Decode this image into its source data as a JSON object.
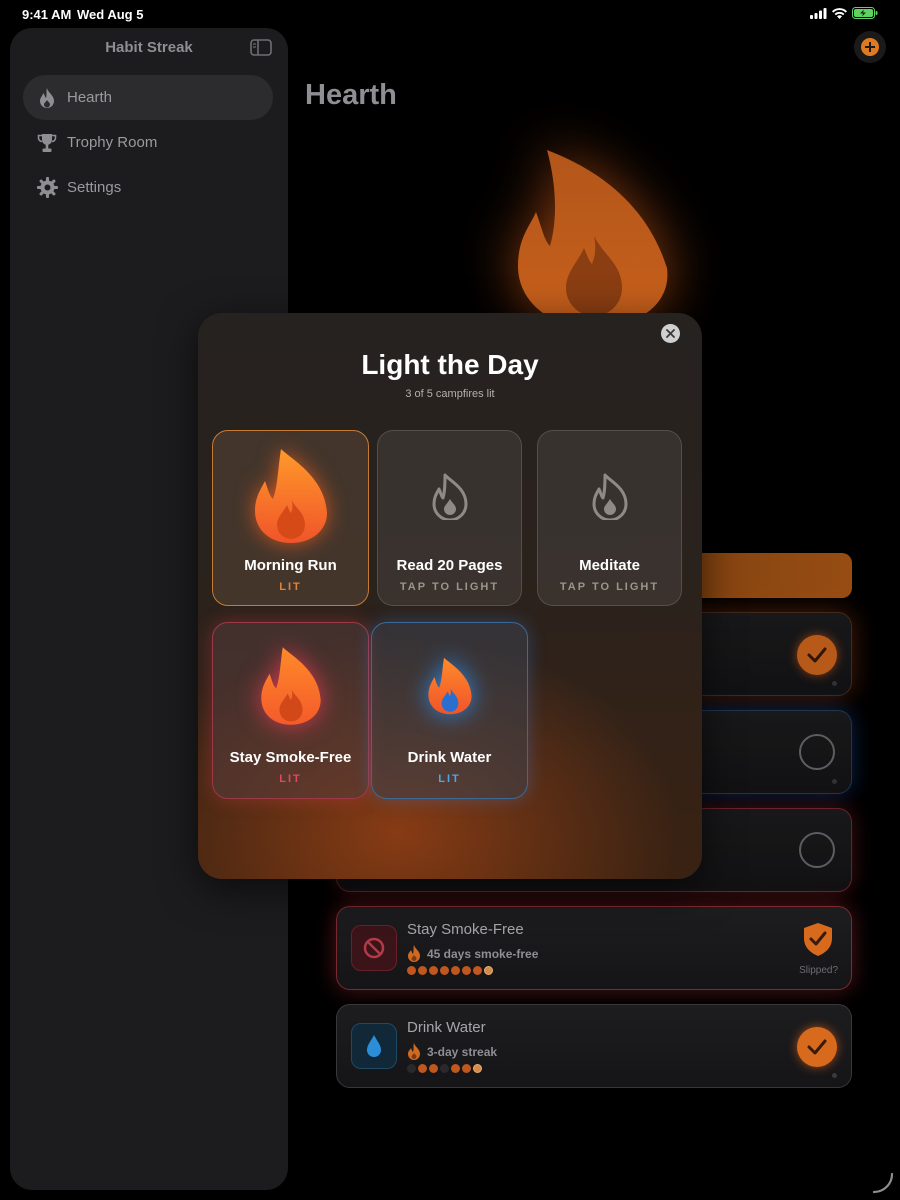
{
  "status_bar": {
    "time": "9:41 AM",
    "date": "Wed Aug 5"
  },
  "sidebar": {
    "title": "Habit Streak",
    "items": [
      {
        "label": "Hearth",
        "icon": "flame-icon",
        "selected": true
      },
      {
        "label": "Trophy Room",
        "icon": "trophy-icon",
        "selected": false
      },
      {
        "label": "Settings",
        "icon": "gear-icon",
        "selected": false
      }
    ]
  },
  "main": {
    "title": "Hearth",
    "habits": [
      {
        "name": "Stay Smoke-Free",
        "sub": "45 days smoke-free",
        "status": "Slipped?"
      },
      {
        "name": "Drink Water",
        "sub": "3-day streak"
      }
    ]
  },
  "modal": {
    "title": "Light the Day",
    "subtitle": "3 of 5 campfires lit",
    "tiles": [
      {
        "name": "Morning Run",
        "state": "LIT"
      },
      {
        "name": "Read 20 Pages",
        "state": "TAP TO LIGHT"
      },
      {
        "name": "Meditate",
        "state": "TAP TO LIGHT"
      },
      {
        "name": "Stay Smoke-Free",
        "state": "LIT"
      },
      {
        "name": "Drink Water",
        "state": "LIT"
      }
    ]
  },
  "colors": {
    "accent_orange": "#e0823a",
    "accent_red": "#e04a5e",
    "accent_blue": "#4aa8e8",
    "background": "#000000",
    "sidebar": "#1c1c1e"
  }
}
